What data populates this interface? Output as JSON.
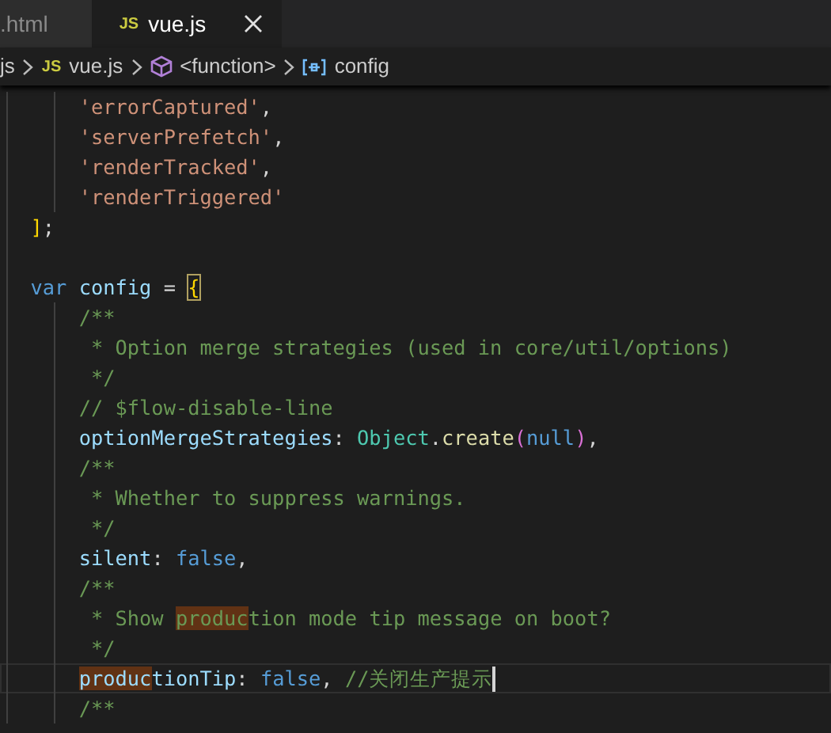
{
  "tabs": [
    {
      "label": ".html",
      "selected": false
    },
    {
      "label": "vue.js",
      "badge": "JS",
      "selected": true
    }
  ],
  "breadcrumb": [
    {
      "kind": "folder",
      "text": "js"
    },
    {
      "kind": "file",
      "badge": "JS",
      "text": "vue.js"
    },
    {
      "kind": "function",
      "text": "<function>"
    },
    {
      "kind": "variable",
      "text": "config"
    }
  ],
  "code": [
    {
      "current": false,
      "tokens": [
        {
          "kind": "string",
          "text": "      'errorCaptured'"
        },
        {
          "kind": "punct",
          "text": ","
        }
      ]
    },
    {
      "current": false,
      "tokens": [
        {
          "kind": "string",
          "text": "      'serverPrefetch'"
        },
        {
          "kind": "punct",
          "text": ","
        }
      ]
    },
    {
      "current": false,
      "tokens": [
        {
          "kind": "string",
          "text": "      'renderTracked'"
        },
        {
          "kind": "punct",
          "text": ","
        }
      ]
    },
    {
      "current": false,
      "tokens": [
        {
          "kind": "string",
          "text": "      'renderTriggered'"
        }
      ]
    },
    {
      "current": false,
      "tokens": [
        {
          "kind": "bracket",
          "text": "  ]"
        },
        {
          "kind": "punct",
          "text": ";"
        }
      ]
    },
    {
      "current": false
    },
    {
      "current": false,
      "tokens": [
        {
          "kind": "keyword",
          "text": "  var "
        },
        {
          "kind": "variable",
          "text": "config "
        },
        {
          "kind": "punct",
          "text": "= "
        },
        {
          "kind": "bracket",
          "text": "{",
          "bracket_pair": true
        }
      ]
    },
    {
      "current": false,
      "tokens": [
        {
          "kind": "comment",
          "text": "      /**"
        }
      ]
    },
    {
      "current": false,
      "tokens": [
        {
          "kind": "comment",
          "text": "       * Option merge strategies (used in core/util/options)"
        }
      ]
    },
    {
      "current": false,
      "tokens": [
        {
          "kind": "comment",
          "text": "       */"
        }
      ]
    },
    {
      "current": false,
      "tokens": [
        {
          "kind": "comment",
          "text": "      // $flow-disable-line"
        }
      ]
    },
    {
      "current": false,
      "tokens": [
        {
          "kind": "variable",
          "text": "      optionMergeStrategies"
        },
        {
          "kind": "punct",
          "text": ": "
        },
        {
          "kind": "class",
          "text": "Object"
        },
        {
          "kind": "punct",
          "text": "."
        },
        {
          "kind": "function",
          "text": "create"
        },
        {
          "kind": "paren",
          "text": "("
        },
        {
          "kind": "keyword",
          "text": "null"
        },
        {
          "kind": "paren",
          "text": ")"
        },
        {
          "kind": "punct",
          "text": ","
        }
      ]
    },
    {
      "current": false,
      "tokens": [
        {
          "kind": "comment",
          "text": "      /**"
        }
      ]
    },
    {
      "current": false,
      "tokens": [
        {
          "kind": "comment",
          "text": "       * Whether to suppress warnings."
        }
      ]
    },
    {
      "current": false,
      "tokens": [
        {
          "kind": "comment",
          "text": "       */"
        }
      ]
    },
    {
      "current": false,
      "tokens": [
        {
          "kind": "variable",
          "text": "      silent"
        },
        {
          "kind": "punct",
          "text": ": "
        },
        {
          "kind": "keyword",
          "text": "false"
        },
        {
          "kind": "punct",
          "text": ","
        }
      ]
    },
    {
      "current": false,
      "tokens": [
        {
          "kind": "comment",
          "text": "      /**"
        }
      ]
    },
    {
      "current": false,
      "tokens": [
        {
          "kind": "comment",
          "text": "       * Show "
        },
        {
          "kind": "comment",
          "text": "produc",
          "match": true
        },
        {
          "kind": "comment",
          "text": "tion mode tip message on boot?"
        }
      ]
    },
    {
      "current": false,
      "tokens": [
        {
          "kind": "comment",
          "text": "       */"
        }
      ]
    },
    {
      "current": true,
      "tokens": [
        {
          "kind": "variable",
          "text": "      produc",
          "match": true
        },
        {
          "kind": "variable",
          "text": "tionTip"
        },
        {
          "kind": "punct",
          "text": ": "
        },
        {
          "kind": "keyword",
          "text": "false"
        },
        {
          "kind": "punct",
          "text": ", "
        },
        {
          "kind": "comment",
          "text": "//关闭生产提示"
        }
      ]
    },
    {
      "current": false,
      "tokens": [
        {
          "kind": "comment",
          "text": "      /**"
        }
      ]
    }
  ]
}
